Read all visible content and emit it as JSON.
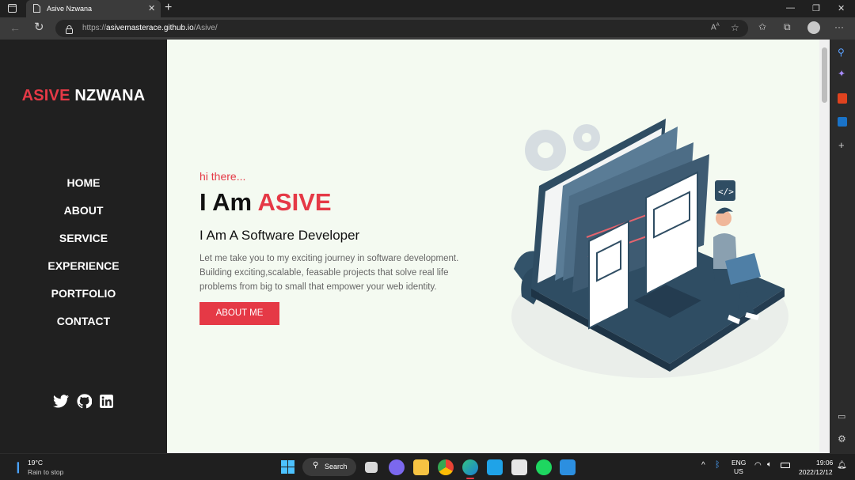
{
  "browser": {
    "tab_title": "Asive Nzwana",
    "new_tab": "+",
    "url_prefix": "https://",
    "url_host": "asivemasterace.github.io",
    "url_path": "/Asive/"
  },
  "sidebar": {
    "logo_first": "ASIVE",
    "logo_last": "NZWANA",
    "nav": [
      "HOME",
      "ABOUT",
      "SERVICE",
      "EXPERIENCE",
      "PORTFOLIO",
      "CONTACT"
    ],
    "social_icons": [
      "twitter-icon",
      "github-icon",
      "linkedin-icon"
    ]
  },
  "hero": {
    "greeting": "hi there...",
    "headline_prefix": "I Am",
    "headline_name": "ASIVE",
    "subtitle": "I Am A Software Developer",
    "intro_line1": "Let me take you to my exciting journey in software development.",
    "intro_line2": "Building exciting,scalable, feasable projects that solve real life",
    "intro_line3": "problems from big to small that empower your web identity.",
    "button_label": "ABOUT ME"
  },
  "colors": {
    "accent": "#e53946",
    "sidebar_bg": "#202020",
    "main_bg": "#f4faf1"
  },
  "taskbar": {
    "weather_temp": "19°C",
    "weather_desc": "Rain to stop",
    "search_label": "Search",
    "lang_top": "ENG",
    "lang_bottom": "US",
    "time": "19:06",
    "date": "2022/12/12"
  }
}
